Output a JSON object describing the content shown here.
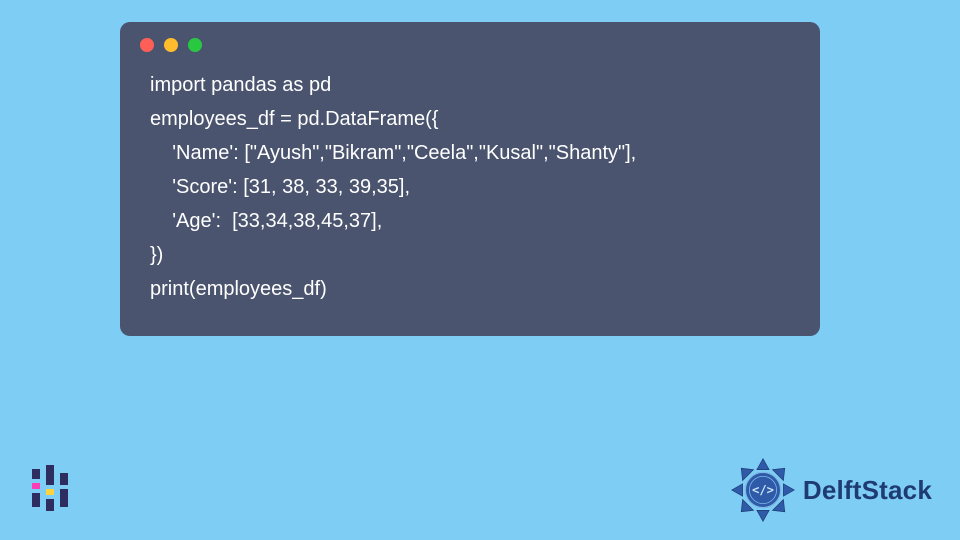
{
  "code": {
    "lines": [
      "import pandas as pd",
      "",
      "employees_df = pd.DataFrame({",
      "    'Name': [\"Ayush\",\"Bikram\",\"Ceela\",\"Kusal\",\"Shanty\"],",
      "    'Score': [31, 38, 33, 39,35],",
      "    'Age':  [33,34,38,45,37],",
      "",
      "})",
      "",
      "print(employees_df)"
    ]
  },
  "brand": {
    "name": "DelftStack"
  },
  "window": {
    "dots": [
      "red",
      "yellow",
      "green"
    ]
  }
}
